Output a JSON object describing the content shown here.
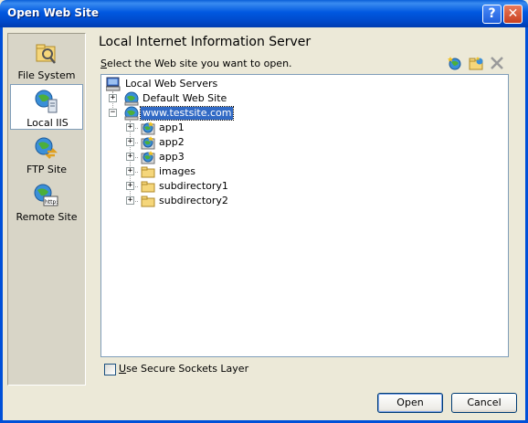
{
  "window": {
    "title": "Open Web Site",
    "help_button": "?",
    "close_button": "✕"
  },
  "places": [
    {
      "label": "File System",
      "icon": "file-system-icon",
      "selected": false
    },
    {
      "label": "Local IIS",
      "icon": "local-iis-icon",
      "selected": true
    },
    {
      "label": "FTP Site",
      "icon": "ftp-site-icon",
      "selected": false
    },
    {
      "label": "Remote Site",
      "icon": "remote-site-icon",
      "selected": false
    }
  ],
  "main": {
    "heading": "Local Internet Information Server",
    "instruction_prefix": "",
    "instruction_accesskey": "S",
    "instruction_rest": "elect the Web site you want to open.",
    "toolbar": [
      "create-web-application-icon",
      "create-virtual-directory-icon",
      "delete-icon"
    ]
  },
  "tree": {
    "root": "Local Web Servers",
    "default_site": "Default Web Site",
    "selected_site": "www.testsite.com",
    "children": [
      {
        "label": "app1",
        "type": "application"
      },
      {
        "label": "app2",
        "type": "application"
      },
      {
        "label": "app3",
        "type": "application"
      },
      {
        "label": "images",
        "type": "folder"
      },
      {
        "label": "subdirectory1",
        "type": "folder"
      },
      {
        "label": "subdirectory2",
        "type": "folder"
      }
    ]
  },
  "options": {
    "ssl_accesskey": "U",
    "ssl_rest": "se Secure Sockets Layer",
    "ssl_checked": false
  },
  "buttons": {
    "open": "Open",
    "cancel": "Cancel"
  }
}
